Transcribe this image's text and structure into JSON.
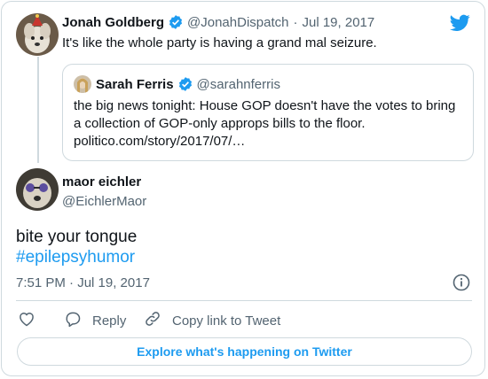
{
  "tweet_quoted_parent": {
    "author_name": "Jonah Goldberg",
    "handle": "@JonahDispatch",
    "separator": "·",
    "date": "Jul 19, 2017",
    "text": "It's like the whole party is having a grand mal seizure."
  },
  "quoted_tweet": {
    "author_name": "Sarah Ferris",
    "handle": "@sarahnferris",
    "text": "the big news tonight: House GOP doesn't have the votes to bring a collection of GOP-only approps bills to the floor.",
    "link": "politico.com/story/2017/07/…"
  },
  "main_tweet": {
    "author_name": "maor eichler",
    "handle": "@EichlerMaor",
    "text": "bite your tongue",
    "hashtag": "#epilepsyhumor",
    "timestamp": "7:51 PM · Jul 19, 2017"
  },
  "actions": {
    "reply_label": "Reply",
    "copy_link_label": "Copy link to Tweet"
  },
  "explore_button": "Explore what's happening on Twitter",
  "colors": {
    "accent": "#1d9bf0",
    "text": "#0f1419",
    "muted": "#536471",
    "border": "#cfd9de"
  },
  "icons": [
    "twitter-bird-icon",
    "verified-badge-icon",
    "info-icon",
    "heart-icon",
    "reply-icon",
    "copy-link-icon"
  ]
}
